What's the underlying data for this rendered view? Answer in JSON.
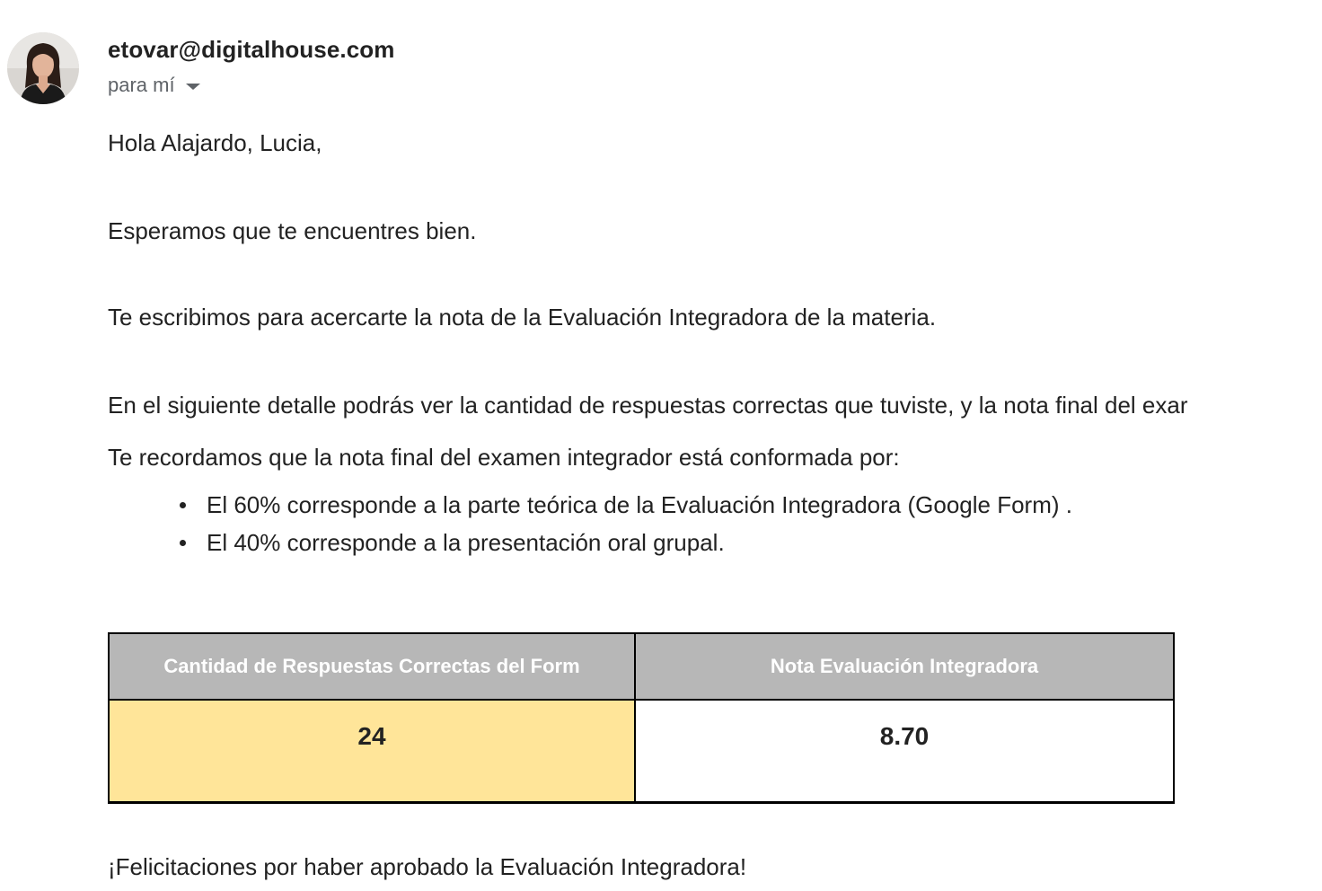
{
  "sender": {
    "email": "etovar@digitalhouse.com",
    "recipient_label": "para mí",
    "avatar_icon": "person-photo-avatar"
  },
  "message": {
    "greeting": "Hola Alajardo, Lucia,",
    "line_1": "Esperamos que te encuentres bien.",
    "line_2": "Te escribimos para acercarte la nota de la Evaluación Integradora de la materia.",
    "line_3": "En el siguiente detalle podrás ver la cantidad de respuestas correctas que tuviste, y la nota final del exar",
    "line_4": "Te recordamos que la nota final del examen integrador está conformada por:",
    "bullets": [
      "El 60% corresponde a la parte teórica de la Evaluación Integradora (Google Form) .",
      "El 40% corresponde a la presentación oral grupal."
    ],
    "closing": "¡Felicitaciones por haber aprobado la Evaluación Integradora!"
  },
  "table": {
    "headers": [
      "Cantidad de Respuestas Correctas del Form",
      "Nota Evaluación Integradora"
    ],
    "row": [
      "24",
      "8.70"
    ],
    "header_bg": "#b7b7b7",
    "highlight_bg": "#ffe599"
  }
}
